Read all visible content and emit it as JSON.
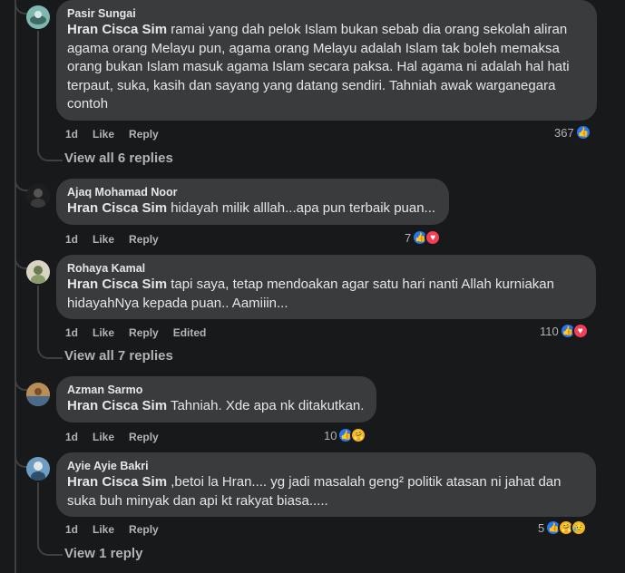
{
  "colors": {
    "background": "#18191a",
    "bubble": "#3a3b3c",
    "like": "#2078f4",
    "love": "#f33e58",
    "care": "#f7b125",
    "muted": "#b0b3b8",
    "text": "#e4e6eb"
  },
  "comments": [
    {
      "author": "Pasir Sungai",
      "tag": "Hran Cisca Sim",
      "text": " ramai yang dah pelok Islam bukan sebab dia orang sekolah aliran agama orang Melayu pun, agama orang Melayu adalah Islam tak boleh memaksa orang bukan Islam masuk agama Islam secara paksa. Hal agama ni adalah hal hati terpaut, suka, kasih dan sayang yang datang sendiri. Tahniah awak warganegara contoh",
      "time": "1d",
      "like": "Like",
      "reply": "Reply",
      "reaction_count": "367",
      "reaction_icons": [
        "like"
      ],
      "view_replies": "View all 6 replies"
    },
    {
      "author": "Ajaq Mohamad Noor",
      "tag": "Hran Cisca Sim",
      "text": " hidayah milik alllah...apa pun terbaik puan...",
      "time": "1d",
      "like": "Like",
      "reply": "Reply",
      "reaction_count": "7",
      "reaction_icons": [
        "like",
        "love"
      ]
    },
    {
      "author": "Rohaya Kamal",
      "tag": "Hran Cisca Sim",
      "text": " tapi saya, tetap mendoakan agar satu hari nanti Allah kurniakan hidayahNya kepada puan.. Aamiiin...",
      "time": "1d",
      "like": "Like",
      "reply": "Reply",
      "edited": "Edited",
      "reaction_count": "110",
      "reaction_icons": [
        "like",
        "love"
      ],
      "view_replies": "View all 7 replies"
    },
    {
      "author": "Azman Sarmo",
      "tag": "Hran Cisca Sim",
      "text": " Tahniah. Xde apa nk ditakutkan.",
      "time": "1d",
      "like": "Like",
      "reply": "Reply",
      "reaction_count": "10",
      "reaction_icons": [
        "like",
        "care"
      ]
    },
    {
      "author": "Ayie Ayie Bakri",
      "tag": "Hran Cisca Sim",
      "text": " ,betoi la Hran.... yg jadi masalah geng² politik atasan ni jahat dan suka buh minyak dan api kt rakyat biasa.....",
      "time": "1d",
      "like": "Like",
      "reply": "Reply",
      "reaction_count": "5",
      "reaction_icons": [
        "like",
        "care",
        "sad"
      ],
      "view_replies": "View 1 reply"
    }
  ]
}
